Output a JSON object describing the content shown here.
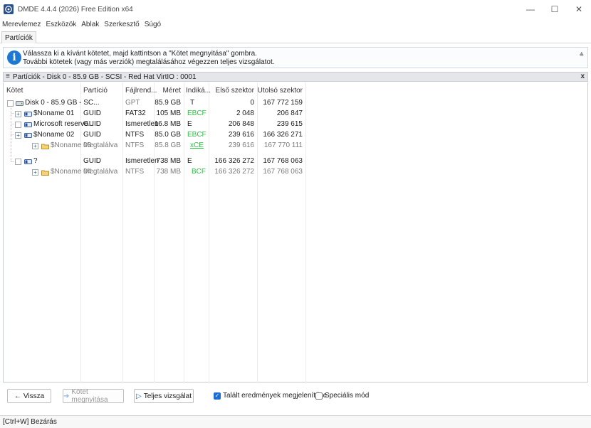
{
  "window": {
    "title": "DMDE 4.4.4 (2026) Free Edition x64",
    "controls": [
      "—",
      "☐",
      "✕"
    ]
  },
  "menu": [
    "Merevlemez",
    "Eszközök",
    "Ablak",
    "Szerkesztő",
    "Súgó"
  ],
  "tab": "Partíciók",
  "info": {
    "line1": "Válassza ki a kívánt kötetet, majd kattintson a \"Kötet megnyitása\" gombra.",
    "line2": "További kötetek (vagy más verziók) megtalálásához végezzen teljes vizsgálatot.",
    "collapse": "≜"
  },
  "panel": {
    "title": "Partíciók - Disk 0 - 85.9 GB - SCSI - Red Hat VirtIO : 0001",
    "close": "x"
  },
  "table": {
    "headers": [
      "Kötet",
      "Partíció",
      "Fájlrend...",
      "Méret",
      "Indiká...",
      "Első szektor",
      "Utolsó szektor"
    ],
    "rows": [
      {
        "name": "Disk 0 - 85.9 GB - SC...",
        "partition": "",
        "fs": "GPT",
        "size": "85.9 GB",
        "ind": "T",
        "first": "0",
        "last": "167 772 159"
      },
      {
        "name": "$Noname 01",
        "partition": "GUID",
        "fs": "FAT32",
        "size": "105 MB",
        "ind": "EBCF",
        "first": "2 048",
        "last": "206 847"
      },
      {
        "name": "Microsoft reserve...",
        "partition": "GUID",
        "fs": "Ismeretlen",
        "size": "16.8 MB",
        "ind": "E",
        "first": "206 848",
        "last": "239 615"
      },
      {
        "name": "$Noname 02",
        "partition": "GUID",
        "fs": "NTFS",
        "size": "85.0 GB",
        "ind": "EBCF",
        "first": "239 616",
        "last": "166 326 271"
      },
      {
        "name": "$Noname 03",
        "partition": "Megtalálva",
        "fs": "NTFS",
        "size": "85.8 GB",
        "ind": "xCE",
        "first": "239 616",
        "last": "167 770 111"
      },
      {
        "name": "?",
        "partition": "GUID",
        "fs": "Ismeretlen",
        "size": "738 MB",
        "ind": "E",
        "first": "166 326 272",
        "last": "167 768 063"
      },
      {
        "name": "$Noname 04",
        "partition": "Megtalálva",
        "fs": "NTFS",
        "size": "738 MB",
        "ind": "BCF",
        "first": "166 326 272",
        "last": "167 768 063"
      }
    ]
  },
  "buttons": {
    "back": "Vissza",
    "open": "Kötet megnyitása",
    "scan": "Teljes vizsgálat",
    "show_found": "Talált eredmények megjelenítése",
    "special": "Speciális mód"
  },
  "status": "[Ctrl+W] Bezárás",
  "colors": {
    "green": "#2fbf45",
    "accent": "#1c6ed4"
  }
}
